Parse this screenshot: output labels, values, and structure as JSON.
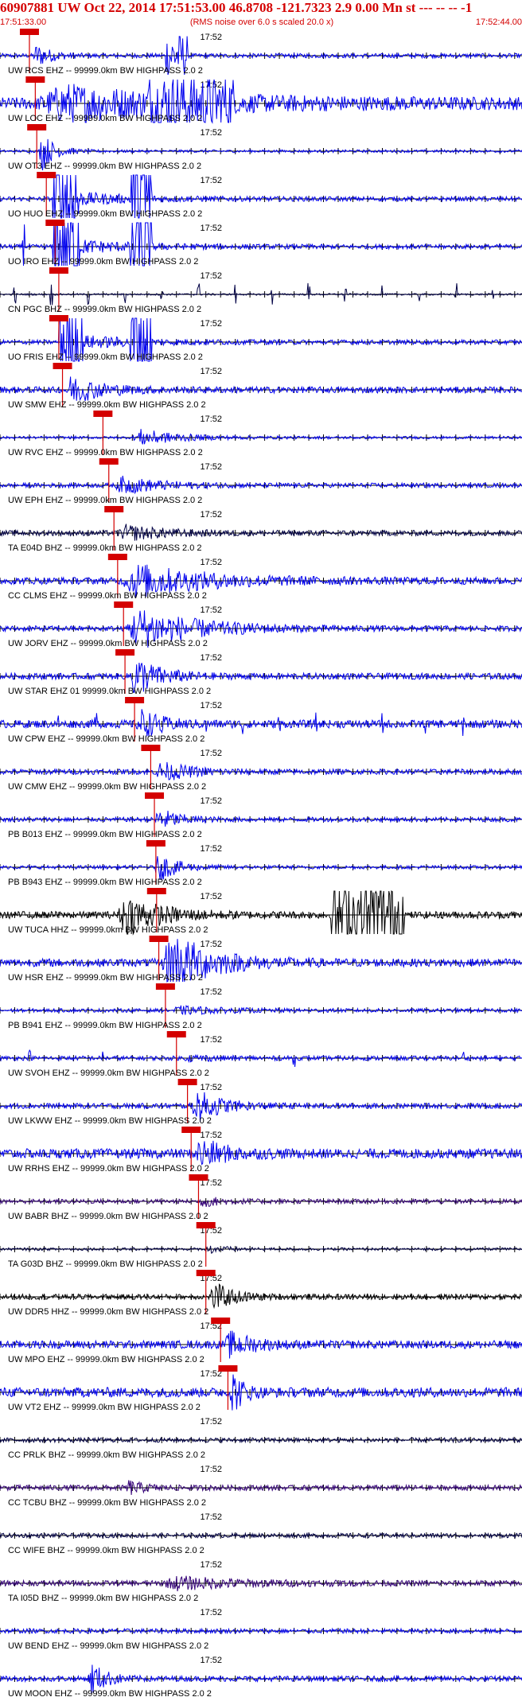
{
  "header": {
    "title": "60907881 UW Oct 22, 2014 17:51:53.00   46.8708 -121.7323  2.9 0.00 Mn st --- -- --   -1",
    "start_time": "17:51:33.00",
    "rms_note": "(RMS noise over 6.0 s scaled 20.0 x)",
    "end_time": "17:52:44.00",
    "color": "#d40000"
  },
  "chart_data": {
    "type": "line",
    "title": "60907881 UW Oct 22, 2014 17:51:53.00   46.8708 -121.7323  2.9 0.00 Mn st --- -- --   -1",
    "x_unit": "time",
    "x_start": "17:51:33.00",
    "x_end": "17:52:44.00",
    "x_range_seconds": [
      0,
      71
    ],
    "minute_mark": {
      "label": "17:52",
      "t_seconds": 27
    },
    "tick_interval_seconds": 2,
    "grid": false,
    "pick_color": "#d40000",
    "traces": [
      {
        "label": "UW RCS EHZ -- 99999.0km BW  HIGHPASS  2.0  2",
        "color": "#0000ee",
        "amp": 0.5,
        "noise": 0.1,
        "pick": 4.0,
        "tp": 4.5,
        "dur": 3,
        "bursts": [
          [
            24.0,
            1.5,
            0.9
          ]
        ],
        "spikes": []
      },
      {
        "label": "UW LOC EHZ -- 99999.0km BW  HIGHPASS  2.0  2",
        "color": "#0000ee",
        "amp": 0.7,
        "noise": 0.28,
        "pick": 4.8,
        "tp": 5.0,
        "dur": 25,
        "bursts": [
          [
            26.0,
            6.0,
            0.8
          ]
        ],
        "spikes": []
      },
      {
        "label": "UW OT3 EHZ -- 99999.0km BW  HIGHPASS  2.0  2",
        "color": "#0000ee",
        "amp": 0.9,
        "noise": 0.06,
        "pick": 5.0,
        "tp": 5.3,
        "dur": 2.5,
        "bursts": [],
        "spikes": []
      },
      {
        "label": "UO HUO EHZ -- 99999.0km BW  HIGHPASS  2.0  2",
        "color": "#0000ee",
        "amp": 0.3,
        "noise": 0.1,
        "pick": 6.3,
        "tp": 7.2,
        "dur": 12,
        "bursts": [
          [
            8.2,
            1.0,
            3.5
          ],
          [
            9.8,
            1.0,
            3.5
          ],
          [
            18.5,
            0.8,
            3.5
          ],
          [
            20.0,
            0.6,
            3.5
          ]
        ],
        "spikes": []
      },
      {
        "label": "UO IRO EHZ -- 99999.0km BW  HIGHPASS  2.0  2",
        "color": "#0000ee",
        "amp": 0.3,
        "noise": 0.1,
        "pick": 7.5,
        "tp": 8.0,
        "dur": 12,
        "bursts": [
          [
            8.2,
            1.0,
            3.5
          ],
          [
            9.8,
            1.0,
            3.5
          ],
          [
            18.5,
            0.8,
            3.5
          ],
          [
            20.0,
            0.6,
            3.5
          ]
        ],
        "spikes": [
          [
            3.2,
            1.2
          ]
        ]
      },
      {
        "label": "CN PGC BHZ -- 99999.0km BW  HIGHPASS  2.0  2",
        "color": "#000044",
        "amp": 0.2,
        "noise": 0.04,
        "pick": 8.0,
        "tp": 0,
        "dur": 0,
        "bursts": [],
        "spikes": [
          [
            2,
            0.5
          ],
          [
            7,
            0.5
          ],
          [
            12,
            0.5
          ],
          [
            17,
            0.5
          ],
          [
            22,
            0.5
          ],
          [
            27,
            0.5
          ],
          [
            32,
            0.5
          ],
          [
            37,
            0.5
          ],
          [
            42,
            0.5
          ],
          [
            47,
            0.5
          ],
          [
            52,
            0.5
          ],
          [
            57,
            0.5
          ],
          [
            62,
            0.5
          ],
          [
            67,
            0.5
          ]
        ]
      },
      {
        "label": "UO FRIS EHZ -- 99999.0km BW  HIGHPASS  2.0  2",
        "color": "#0000ee",
        "amp": 0.3,
        "noise": 0.1,
        "pick": 8.0,
        "tp": 8.0,
        "dur": 12,
        "bursts": [
          [
            9.0,
            1.0,
            3.5
          ],
          [
            10.5,
            0.8,
            3.5
          ],
          [
            18.5,
            0.8,
            3.5
          ],
          [
            20.0,
            0.6,
            3.5
          ]
        ],
        "spikes": []
      },
      {
        "label": "UW SMW EHZ -- 99999.0km BW  HIGHPASS  2.0  2",
        "color": "#0000ee",
        "amp": 0.6,
        "noise": 0.14,
        "pick": 8.5,
        "tp": 8.8,
        "dur": 6,
        "bursts": [],
        "spikes": []
      },
      {
        "label": "UW RVC EHZ -- 99999.0km BW  HIGHPASS  2.0  2",
        "color": "#0000ee",
        "amp": 0.35,
        "noise": 0.06,
        "pick": 14.0,
        "tp": 18.0,
        "dur": 8,
        "bursts": [],
        "spikes": []
      },
      {
        "label": "UW EPH EHZ -- 99999.0km BW  HIGHPASS  2.0  2",
        "color": "#0000ee",
        "amp": 0.35,
        "noise": 0.1,
        "pick": 14.8,
        "tp": 15.5,
        "dur": 8,
        "bursts": [],
        "spikes": []
      },
      {
        "label": "TA E04D BHZ -- 99999.0km BW  HIGHPASS  2.0  2",
        "color": "#000044",
        "amp": 0.3,
        "noise": 0.12,
        "pick": 15.5,
        "tp": 16.0,
        "dur": 8,
        "bursts": [],
        "spikes": []
      },
      {
        "label": "CC CLMS EHZ -- 99999.0km BW  HIGHPASS  2.0  2",
        "color": "#0000ee",
        "amp": 0.7,
        "noise": 0.16,
        "pick": 16.0,
        "tp": 16.5,
        "dur": 14,
        "bursts": [],
        "spikes": []
      },
      {
        "label": "UW JORV EHZ -- 99999.0km BW  HIGHPASS  2.0  2",
        "color": "#0000ee",
        "amp": 0.9,
        "noise": 0.12,
        "pick": 16.8,
        "tp": 17.0,
        "dur": 12,
        "bursts": [],
        "spikes": []
      },
      {
        "label": "UW STAR EHZ 01 99999.0km BW  HIGHPASS  2.0  2",
        "color": "#0000ee",
        "amp": 0.9,
        "noise": 0.14,
        "pick": 17.0,
        "tp": 17.5,
        "dur": 5,
        "bursts": [],
        "spikes": []
      },
      {
        "label": "UW CPW EHZ -- 99999.0km BW  HIGHPASS  2.0  2",
        "color": "#0000ee",
        "amp": 0.6,
        "noise": 0.18,
        "pick": 18.3,
        "tp": 18.5,
        "dur": 4,
        "bursts": [],
        "spikes": [
          [
            8,
            0.45
          ],
          [
            13,
            0.45
          ],
          [
            22,
            0.45
          ],
          [
            28,
            0.45
          ],
          [
            33,
            0.45
          ],
          [
            38,
            0.45
          ],
          [
            43,
            0.45
          ],
          [
            52,
            0.45
          ],
          [
            58,
            0.45
          ],
          [
            63,
            0.45
          ]
        ]
      },
      {
        "label": "UW CMW EHZ -- 99999.0km BW  HIGHPASS  2.0  2",
        "color": "#0000ee",
        "amp": 0.4,
        "noise": 0.12,
        "pick": 20.5,
        "tp": 21.0,
        "dur": 6,
        "bursts": [],
        "spikes": []
      },
      {
        "label": "PB B013 EHZ -- 99999.0km BW  HIGHPASS  2.0  2",
        "color": "#0000ee",
        "amp": 0.5,
        "noise": 0.1,
        "pick": 21.0,
        "tp": 21.0,
        "dur": 4,
        "bursts": [],
        "spikes": []
      },
      {
        "label": "PB B943 EHZ -- 99999.0km BW  HIGHPASS  2.0  2",
        "color": "#0000ee",
        "amp": 0.6,
        "noise": 0.08,
        "pick": 21.2,
        "tp": 21.0,
        "dur": 4,
        "bursts": [],
        "spikes": []
      },
      {
        "label": "UW TUCA HHZ -- 99999.0km BW  HIGHPASS  2.0  2",
        "color": "#000000",
        "amp": 0.9,
        "noise": 0.16,
        "pick": 21.3,
        "tp": 16.0,
        "dur": 7,
        "bursts": [
          [
            50.0,
            5.0,
            1.6
          ]
        ],
        "spikes": []
      },
      {
        "label": "UW HSR EHZ -- 99999.0km BW  HIGHPASS  2.0  2",
        "color": "#0000ee",
        "amp": 1.4,
        "noise": 0.18,
        "pick": 21.6,
        "tp": 22.0,
        "dur": 8,
        "bursts": [],
        "spikes": []
      },
      {
        "label": "PB B941 EHZ -- 99999.0km BW  HIGHPASS  2.0  2",
        "color": "#0000ee",
        "amp": 0.15,
        "noise": 0.08,
        "pick": 22.5,
        "tp": 23.0,
        "dur": 10,
        "bursts": [],
        "spikes": []
      },
      {
        "label": "UW SVOH EHZ -- 99999.0km BW  HIGHPASS  2.0  2",
        "color": "#0000ee",
        "amp": 0.1,
        "noise": 0.1,
        "pick": 24.0,
        "tp": 25.0,
        "dur": 6,
        "bursts": [],
        "spikes": [
          [
            4,
            0.3
          ],
          [
            14,
            0.3
          ],
          [
            40,
            0.3
          ],
          [
            63,
            0.3
          ]
        ]
      },
      {
        "label": "UW LKWW EHZ -- 99999.0km BW  HIGHPASS  2.0  2",
        "color": "#0000ee",
        "amp": 0.7,
        "noise": 0.12,
        "pick": 25.5,
        "tp": 26.0,
        "dur": 5,
        "bursts": [],
        "spikes": []
      },
      {
        "label": "UW RRHS EHZ -- 99999.0km BW  HIGHPASS  2.0  2",
        "color": "#0000ee",
        "amp": 0.6,
        "noise": 0.22,
        "pick": 26.0,
        "tp": 26.5,
        "dur": 5,
        "bursts": [],
        "spikes": []
      },
      {
        "label": "UW BABR BHZ -- 99999.0km BW  HIGHPASS  2.0  2",
        "color": "#330077",
        "amp": 0.2,
        "noise": 0.1,
        "pick": 27.0,
        "tp": 27.0,
        "dur": 4,
        "bursts": [],
        "spikes": []
      },
      {
        "label": "TA G03D BHZ -- 99999.0km BW  HIGHPASS  2.0  2",
        "color": "#000044",
        "amp": 0.15,
        "noise": 0.06,
        "pick": 28.0,
        "tp": 28.0,
        "dur": 4,
        "bursts": [],
        "spikes": []
      },
      {
        "label": "UW DDR5 HHZ -- 99999.0km BW  HIGHPASS  2.0  2",
        "color": "#000000",
        "amp": 0.6,
        "noise": 0.12,
        "pick": 28.0,
        "tp": 28.5,
        "dur": 4,
        "bursts": [],
        "spikes": []
      },
      {
        "label": "UW MPO EHZ -- 99999.0km BW  HIGHPASS  2.0  2",
        "color": "#0000ee",
        "amp": 0.5,
        "noise": 0.18,
        "pick": 30.0,
        "tp": 30.5,
        "dur": 5,
        "bursts": [],
        "spikes": []
      },
      {
        "label": "UW VT2 EHZ -- 99999.0km BW  HIGHPASS  2.0  2",
        "color": "#0000ee",
        "amp": 1.0,
        "noise": 0.22,
        "pick": 31.0,
        "tp": 31.3,
        "dur": 2,
        "bursts": [],
        "spikes": []
      },
      {
        "label": "CC PRLK BHZ -- 99999.0km BW  HIGHPASS  2.0  2",
        "color": "#000044",
        "amp": 0.0,
        "noise": 0.1,
        "pick": null,
        "tp": 0,
        "dur": 0,
        "bursts": [],
        "spikes": []
      },
      {
        "label": "CC TCBU BHZ -- 99999.0km BW  HIGHPASS  2.0  2",
        "color": "#330077",
        "amp": 0.3,
        "noise": 0.12,
        "pick": null,
        "tp": 17.0,
        "dur": 3,
        "bursts": [],
        "spikes": []
      },
      {
        "label": "CC WIFE BHZ -- 99999.0km BW  HIGHPASS  2.0  2",
        "color": "#000044",
        "amp": 0.0,
        "noise": 0.1,
        "pick": null,
        "tp": 0,
        "dur": 0,
        "bursts": [],
        "spikes": []
      },
      {
        "label": "TA I05D BHZ -- 99999.0km BW  HIGHPASS  2.0  2",
        "color": "#330077",
        "amp": 0.25,
        "noise": 0.12,
        "pick": null,
        "tp": 22.0,
        "dur": 14,
        "bursts": [],
        "spikes": []
      },
      {
        "label": "UW BEND EHZ -- 99999.0km BW  HIGHPASS  2.0  2",
        "color": "#0000ee",
        "amp": 0.0,
        "noise": 0.1,
        "pick": null,
        "tp": 0,
        "dur": 0,
        "bursts": [],
        "spikes": []
      },
      {
        "label": "UW MOON EHZ -- 99999.0km BW  HIGHPASS  2.0  2",
        "color": "#0000ee",
        "amp": 0.7,
        "noise": 0.12,
        "pick": null,
        "tp": 12.0,
        "dur": 3,
        "bursts": [],
        "spikes": []
      }
    ]
  }
}
